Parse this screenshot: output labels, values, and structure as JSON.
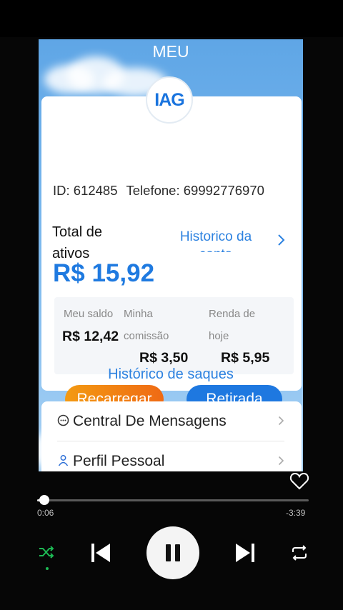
{
  "app": {
    "title": "MEU",
    "logo_text": "IAG"
  },
  "account": {
    "id_text": "ID: 612485",
    "phone_text": "Telefone: 69992776970"
  },
  "summary": {
    "total_label": "Total de ativos",
    "total_value": "R$ 15,92",
    "history_link": "Historico da conta"
  },
  "stats": [
    {
      "label": "Meu saldo",
      "value": "R$ 12,42"
    },
    {
      "label": "Minha comissão",
      "value": "R$ 3,50"
    },
    {
      "label": "Renda de hoje",
      "value": "R$ 5,95"
    }
  ],
  "actions": {
    "recharge_label": "Recarregar",
    "withdraw_label": "Retirada",
    "withdraw_history_link": "Histórico de saques"
  },
  "menu": [
    {
      "label": "Central De Mensagens",
      "icon": "chat-bubble-icon"
    },
    {
      "label": "Perfil Pessoal",
      "icon": "person-icon"
    }
  ],
  "player": {
    "elapsed": "0:06",
    "remaining": "-3:39",
    "progress": 0.027,
    "shuffle_active": true,
    "state": "playing",
    "accent_color": "#1db954"
  },
  "colors": {
    "brand_blue": "#1f7ae0",
    "recharge_gradient": [
      "#f39a12",
      "#ef6a14"
    ],
    "withdraw": "#1e78e0"
  }
}
